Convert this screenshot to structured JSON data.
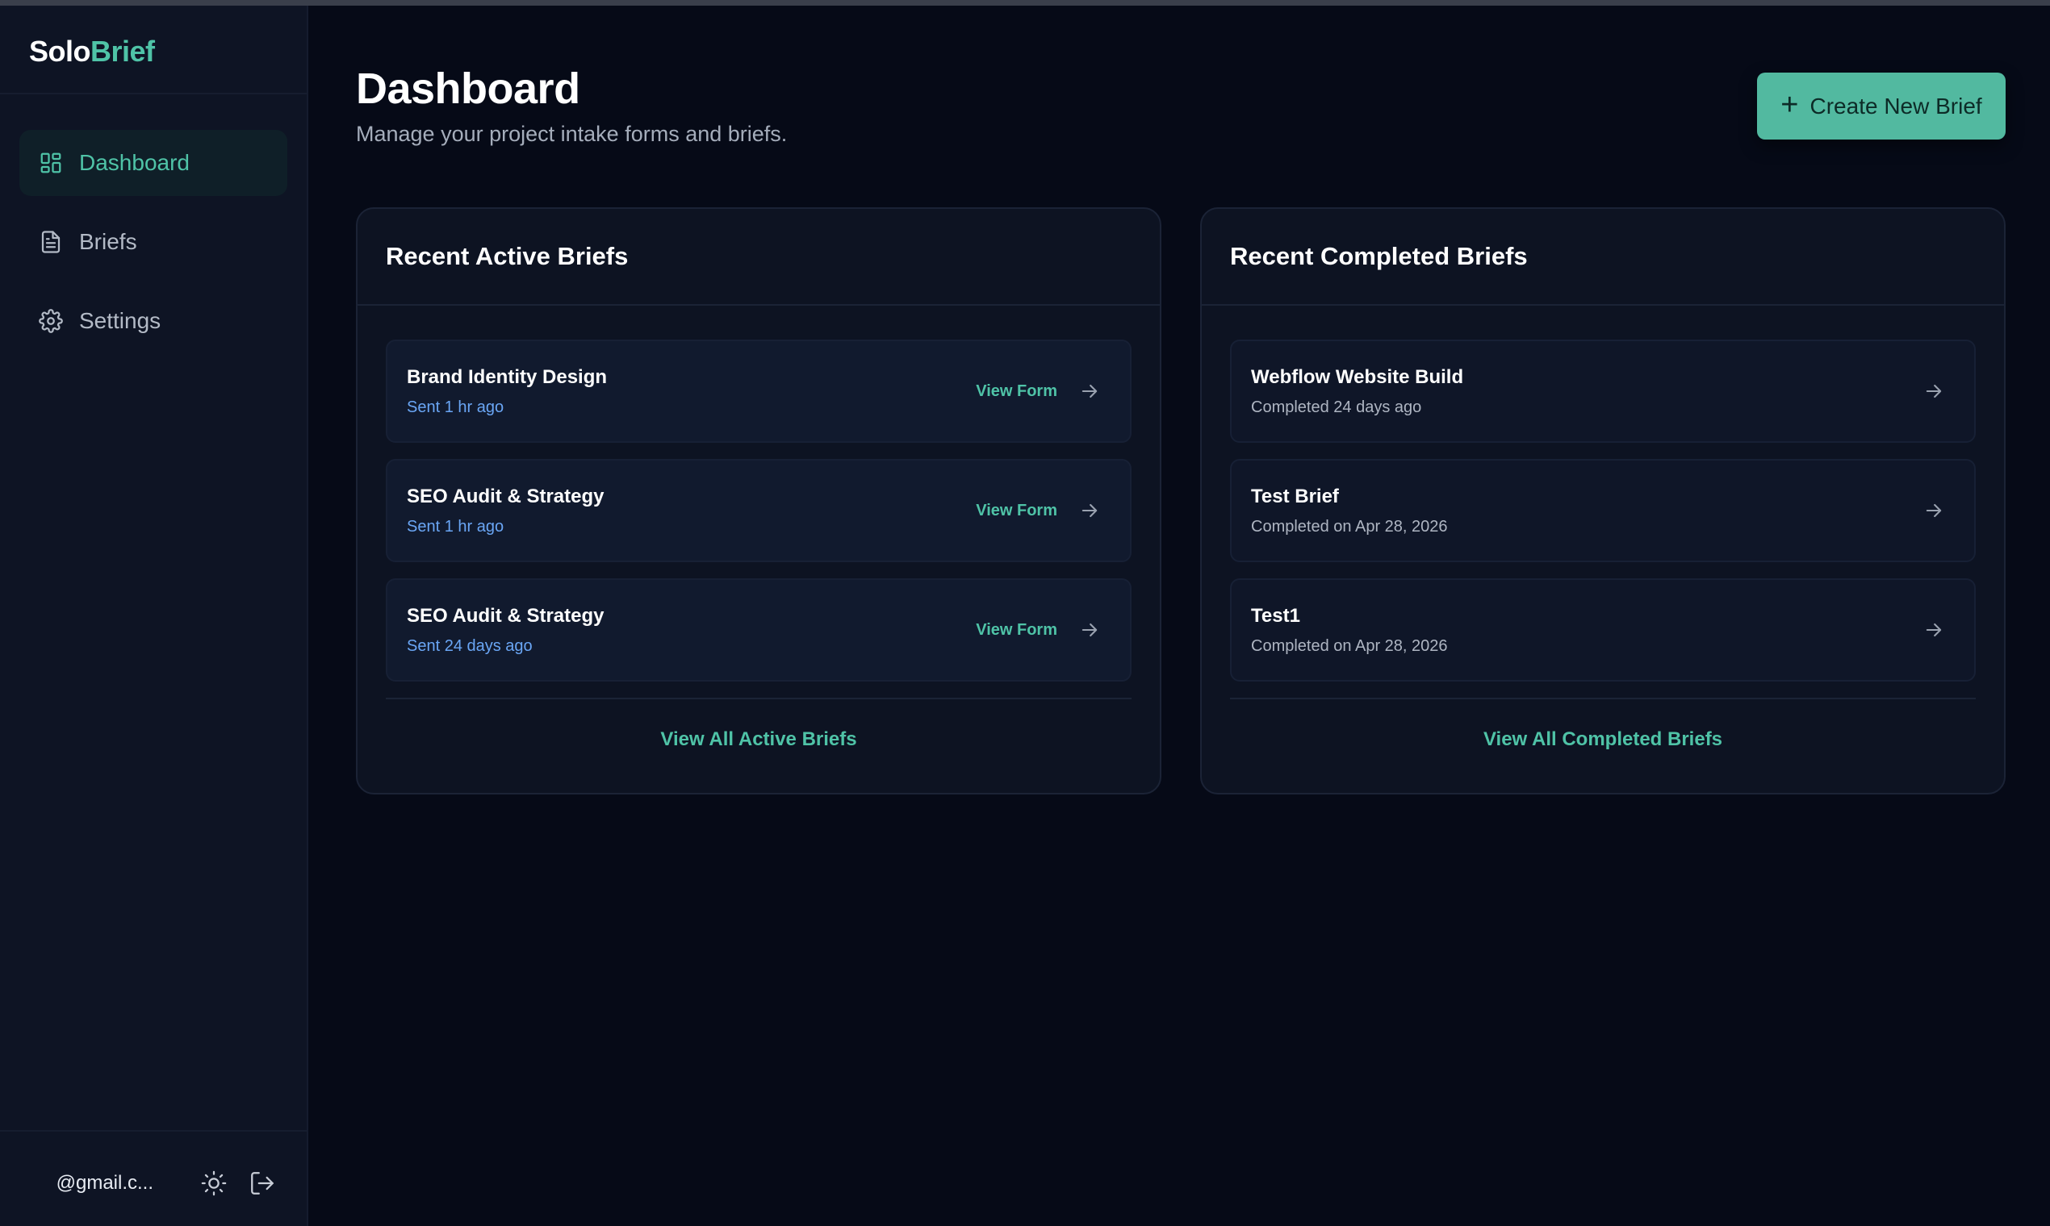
{
  "brand": {
    "part1": "Solo",
    "part2": "Brief"
  },
  "sidebar": {
    "items": [
      {
        "label": "Dashboard",
        "icon": "layout-grid-icon"
      },
      {
        "label": "Briefs",
        "icon": "file-text-icon"
      },
      {
        "label": "Settings",
        "icon": "gear-icon"
      }
    ],
    "user_email": "@gmail.c..."
  },
  "header": {
    "title": "Dashboard",
    "subtitle": "Manage your project intake forms and briefs.",
    "create_button": "Create New Brief"
  },
  "active_briefs": {
    "title": "Recent Active Briefs",
    "action_label": "View Form",
    "items": [
      {
        "name": "Brand Identity Design",
        "meta": "Sent 1 hr ago"
      },
      {
        "name": "SEO Audit & Strategy",
        "meta": "Sent 1 hr ago"
      },
      {
        "name": "SEO Audit & Strategy",
        "meta": "Sent 24 days ago"
      }
    ],
    "view_all": "View All Active Briefs"
  },
  "completed_briefs": {
    "title": "Recent Completed Briefs",
    "items": [
      {
        "name": "Webflow Website Build",
        "meta": "Completed 24 days ago"
      },
      {
        "name": "Test Brief",
        "meta": "Completed on Apr 28, 2026"
      },
      {
        "name": "Test1",
        "meta": "Completed on Apr 28, 2026"
      }
    ],
    "view_all": "View All Completed Briefs"
  },
  "colors": {
    "accent": "#4fc3a7",
    "button": "#52b9a0",
    "link_blue": "#6aa6f5",
    "background": "#060a17",
    "sidebar": "#0e1424",
    "card": "#0d1322"
  }
}
